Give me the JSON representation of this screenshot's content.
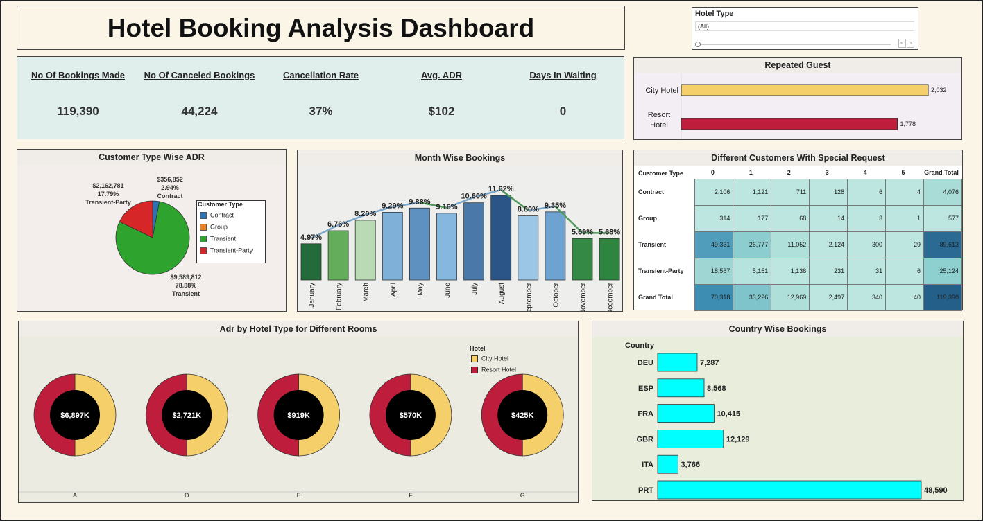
{
  "title": "Hotel Booking Analysis Dashboard",
  "filter": {
    "label": "Hotel Type",
    "value": "(All)",
    "prev": "<",
    "next": ">"
  },
  "kpis": [
    {
      "label": "No Of Bookings Made",
      "value": "119,390"
    },
    {
      "label": "No Of Canceled Bookings",
      "value": "44,224"
    },
    {
      "label": "Cancellation Rate",
      "value": "37%"
    },
    {
      "label": "Avg. ADR",
      "value": "$102"
    },
    {
      "label": "Days In Waiting",
      "value": "0"
    }
  ],
  "repeated_guest": {
    "title": "Repeated Guest",
    "chart_data": {
      "type": "bar",
      "orientation": "horizontal",
      "categories": [
        "City Hotel",
        "Resort Hotel"
      ],
      "values": [
        2032,
        1778
      ],
      "labels": [
        "2,032",
        "1,778"
      ],
      "colors": [
        "#f5cf6a",
        "#be1e3c"
      ]
    }
  },
  "customer_adr": {
    "title": "Customer Type Wise ADR",
    "legend_title": "Customer Type",
    "chart_data": {
      "type": "pie",
      "slices": [
        {
          "name": "Contract",
          "value": 356852,
          "label1": "$356,852",
          "label2": "2.94%",
          "color": "#2f72b3"
        },
        {
          "name": "Group",
          "value": 0,
          "label1": "",
          "label2": "",
          "color": "#f28020"
        },
        {
          "name": "Transient",
          "value": 9589812,
          "label1": "$9,589,812",
          "label2": "78.88%",
          "color": "#2ea32e"
        },
        {
          "name": "Transient-Party",
          "value": 2162781,
          "label1": "$2,162,781",
          "label2": "17.79%",
          "color": "#d72627"
        }
      ]
    }
  },
  "month_bookings": {
    "title": "Month Wise Bookings",
    "chart_data": {
      "type": "bar",
      "categories": [
        "January",
        "February",
        "March",
        "April",
        "May",
        "June",
        "July",
        "August",
        "September",
        "October",
        "November",
        "December"
      ],
      "values": [
        4.97,
        6.76,
        8.2,
        9.29,
        9.88,
        9.16,
        10.6,
        11.62,
        8.8,
        9.35,
        5.69,
        5.68
      ],
      "labels": [
        "4.97%",
        "6.76%",
        "8.20%",
        "9.29%",
        "9.88%",
        "9.16%",
        "10.60%",
        "11.62%",
        "8.80%",
        "9.35%",
        "5.69%",
        "5.68%"
      ],
      "colors": [
        "#236b3a",
        "#63ad5b",
        "#b9dab5",
        "#7fb0d8",
        "#5f91c0",
        "#86b7df",
        "#4a78a8",
        "#2b5587",
        "#9cc6e6",
        "#6ea3d1",
        "#348a44",
        "#2e8540"
      ],
      "ylim": [
        0,
        12
      ]
    }
  },
  "special_requests": {
    "title": "Different Customers With Special Request",
    "corner": "Customer Type",
    "columns": [
      "0",
      "1",
      "2",
      "3",
      "4",
      "5",
      "Grand Total"
    ],
    "rows": [
      {
        "label": "Contract",
        "cells": [
          "2,106",
          "1,121",
          "711",
          "128",
          "6",
          "4",
          "4,076"
        ],
        "colors": [
          "#bde6e0",
          "#bde6e0",
          "#bde6e0",
          "#bde6e0",
          "#bde6e0",
          "#bde6e0",
          "#a9dcd6"
        ]
      },
      {
        "label": "Group",
        "cells": [
          "314",
          "177",
          "68",
          "14",
          "3",
          "1",
          "577"
        ],
        "colors": [
          "#bde6e0",
          "#bde6e0",
          "#bde6e0",
          "#bde6e0",
          "#bde6e0",
          "#bde6e0",
          "#bde6e0"
        ]
      },
      {
        "label": "Transient",
        "cells": [
          "49,331",
          "26,777",
          "11,052",
          "2,124",
          "300",
          "29",
          "89,613"
        ],
        "colors": [
          "#4f9dba",
          "#8ccdcf",
          "#b0e0da",
          "#bde6e0",
          "#bde6e0",
          "#bde6e0",
          "#2a6a93"
        ]
      },
      {
        "label": "Transient-Party",
        "cells": [
          "18,567",
          "5,151",
          "1,138",
          "231",
          "31",
          "6",
          "25,124"
        ],
        "colors": [
          "#9fd6d4",
          "#b6e3dd",
          "#bde6e0",
          "#bde6e0",
          "#bde6e0",
          "#bde6e0",
          "#8ecfcf"
        ]
      },
      {
        "label": "Grand Total",
        "cells": [
          "70,318",
          "33,226",
          "12,969",
          "2,497",
          "340",
          "40",
          "119,390"
        ],
        "colors": [
          "#3d8cb2",
          "#7fc4cb",
          "#aedfd9",
          "#bde6e0",
          "#bde6e0",
          "#bde6e0",
          "#245f8a"
        ]
      }
    ]
  },
  "room_adr": {
    "title": "Adr by Hotel Type for Different Rooms",
    "legend_title": "Hotel",
    "legend": [
      {
        "name": "City Hotel",
        "color": "#f5cf6a"
      },
      {
        "name": "Resort Hotel",
        "color": "#be1e3c"
      }
    ],
    "chart_data": {
      "type": "pie",
      "categories": [
        "A",
        "D",
        "E",
        "F",
        "G"
      ],
      "totals": [
        "$6,897K",
        "$2,721K",
        "$919K",
        "$570K",
        "$425K"
      ]
    }
  },
  "country_bookings": {
    "title": "Country Wise Bookings",
    "axis_label": "Country",
    "chart_data": {
      "type": "bar",
      "orientation": "horizontal",
      "categories": [
        "DEU",
        "ESP",
        "FRA",
        "GBR",
        "ITA",
        "PRT"
      ],
      "values": [
        7287,
        8568,
        10415,
        12129,
        3766,
        48590
      ],
      "labels": [
        "7,287",
        "8,568",
        "10,415",
        "12,129",
        "3,766",
        "48,590"
      ],
      "color": "#00ffff"
    }
  }
}
